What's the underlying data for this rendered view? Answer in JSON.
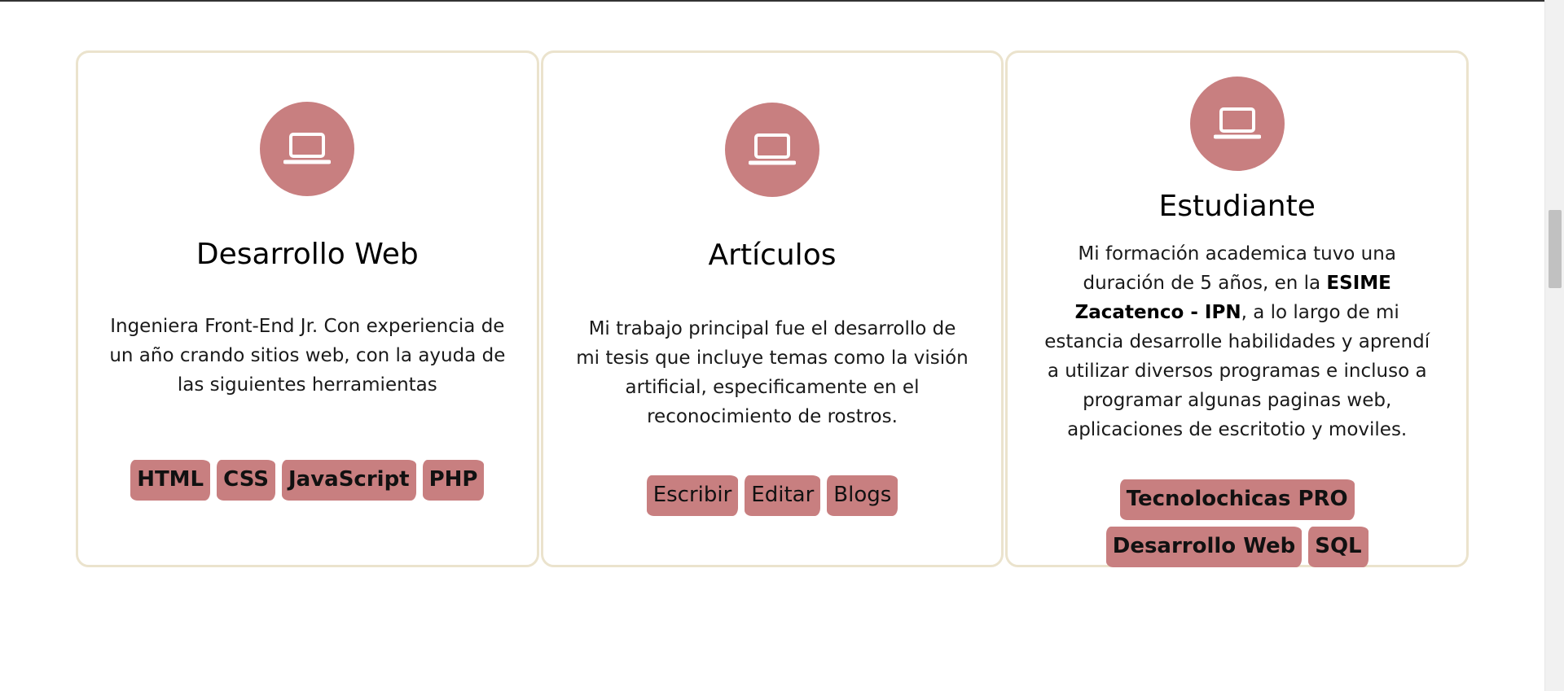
{
  "cards": [
    {
      "icon": "laptop-icon",
      "title": "Desarrollo Web",
      "description": "Ingeniera Front-End Jr. Con experiencia de un año crando sitios web, con la ayuda de las siguientes herramientas",
      "tags": [
        "HTML",
        "CSS",
        "JavaScript",
        "PHP"
      ]
    },
    {
      "icon": "laptop-icon",
      "title": "Artículos",
      "description": "Mi trabajo principal fue el desarrollo de mi tesis que incluye temas como la visión artificial, especificamente en el reconocimiento de rostros.",
      "tags": [
        "Escribir",
        "Editar",
        "Blogs"
      ]
    },
    {
      "icon": "laptop-icon",
      "title": "Estudiante",
      "description_before": "Mi formación academica tuvo una duración de 5 años, en la ",
      "description_bold": "ESIME Zacatenco - IPN",
      "description_after": ", a lo largo de mi estancia desarrolle habilidades y aprendí a utilizar diversos programas e incluso a programar algunas paginas web, aplicaciones de escritotio y moviles.",
      "tags": [
        "Tecnolochicas PRO",
        "Desarrollo Web",
        "SQL"
      ]
    }
  ],
  "colors": {
    "accent": "#c87f80",
    "card_border": "#ebe3cd"
  }
}
